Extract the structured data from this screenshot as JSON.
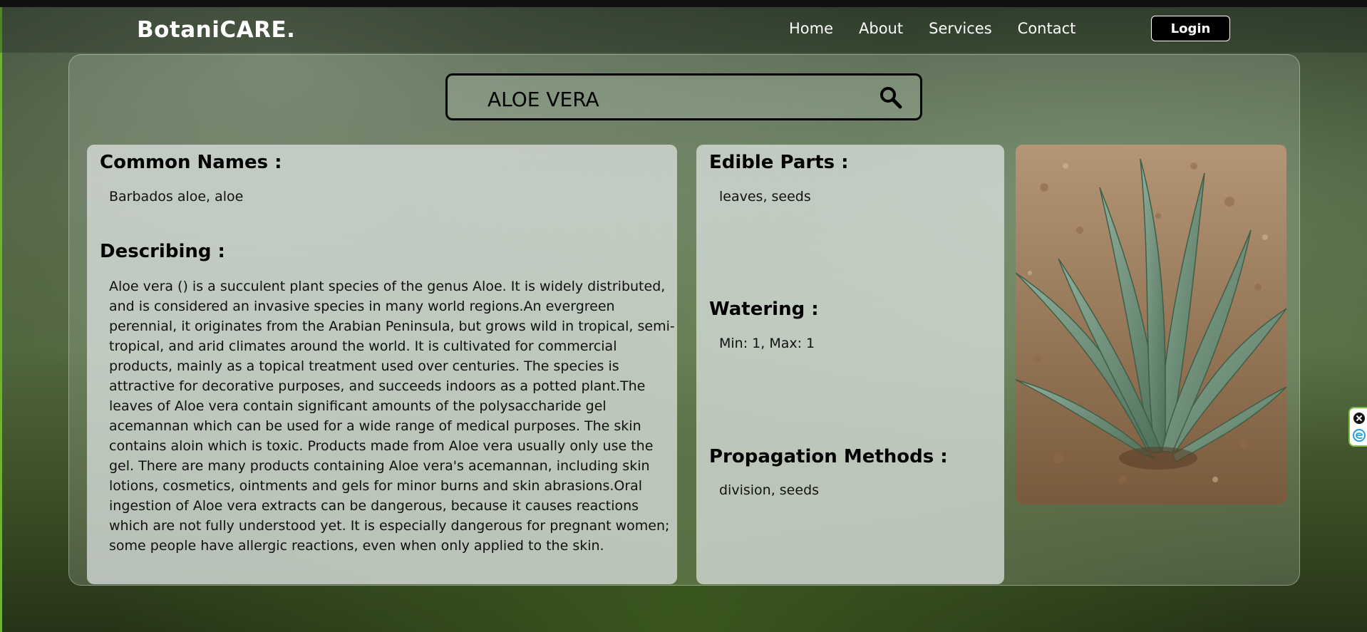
{
  "header": {
    "brand": "BotaniCARE.",
    "nav": [
      "Home",
      "About",
      "Services",
      "Contact"
    ],
    "login_label": "Login"
  },
  "search": {
    "value": "ALOE VERA"
  },
  "plant": {
    "common_names_heading": "Common Names :",
    "common_names": "Barbados aloe, aloe",
    "describing_heading": "Describing :",
    "description": "Aloe vera () is a succulent plant species of the genus Aloe. It is widely distributed, and is considered an invasive species in many world regions.An evergreen perennial, it originates from the Arabian Peninsula, but grows wild in tropical, semi-tropical, and arid climates around the world. It is cultivated for commercial products, mainly as a topical treatment used over centuries. The species is attractive for decorative purposes, and succeeds indoors as a potted plant.The leaves of Aloe vera contain significant amounts of the polysaccharide gel acemannan which can be used for a wide range of medical purposes. The skin contains aloin which is toxic. Products made from Aloe vera usually only use the gel. There are many products containing Aloe vera's acemannan, including skin lotions, cosmetics, ointments and gels for minor burns and skin abrasions.Oral ingestion of Aloe vera extracts can be dangerous, because it causes reactions which are not fully understood yet. It is especially dangerous for pregnant women; some people have allergic reactions, even when only applied to the skin.",
    "edible_heading": "Edible Parts :",
    "edible": "leaves, seeds",
    "watering_heading": "Watering :",
    "watering": "Min: 1, Max: 1",
    "propagation_heading": "Propagation Methods :",
    "propagation": "division, seeds"
  },
  "icons": {
    "search": "search-icon",
    "widget_close": "close-icon",
    "widget_e": "e-icon"
  },
  "colors": {
    "accent_green": "#7ac142",
    "login_bg": "#000000"
  }
}
